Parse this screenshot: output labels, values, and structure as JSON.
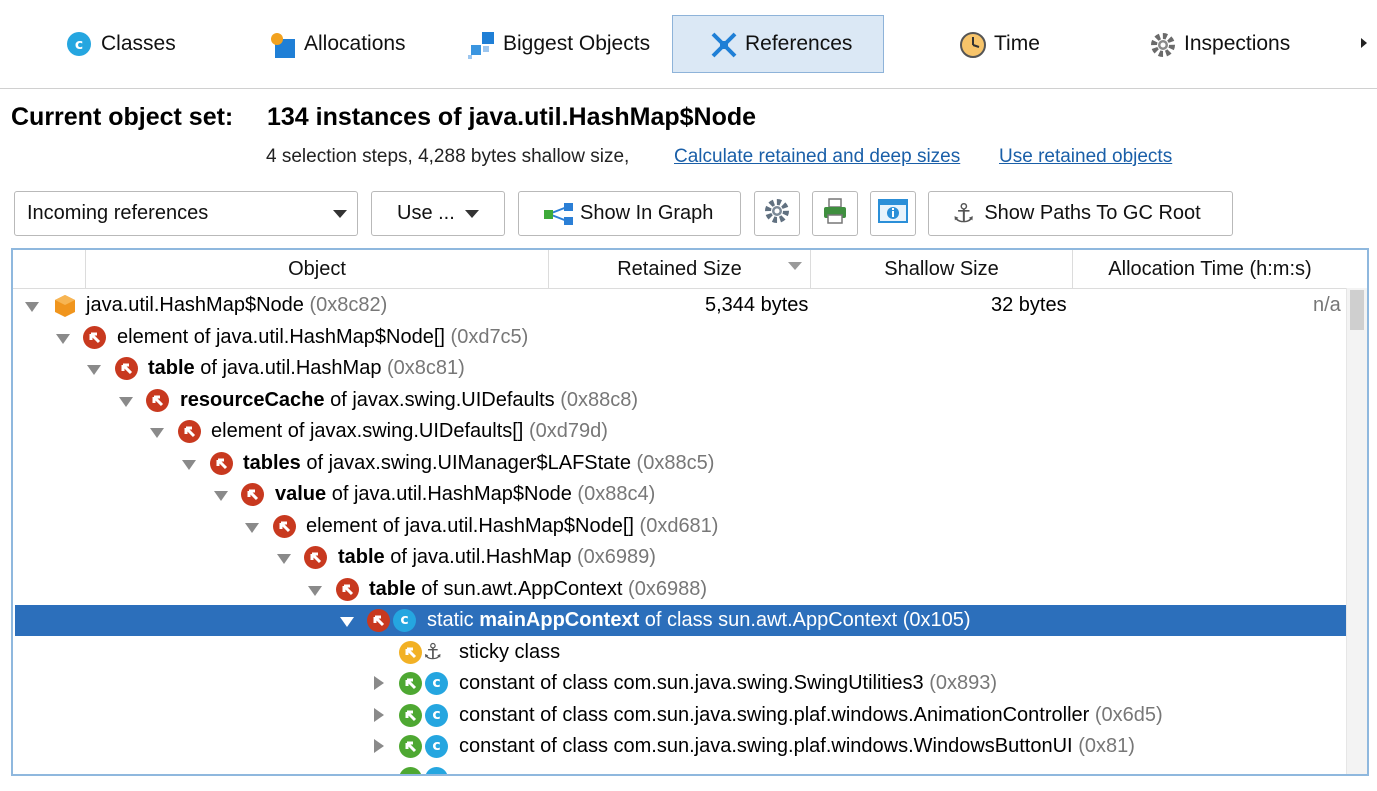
{
  "tabs": [
    {
      "label": "Classes",
      "icon": "classes-icon"
    },
    {
      "label": "Allocations",
      "icon": "allocations-icon"
    },
    {
      "label": "Biggest Objects",
      "icon": "biggest-objects-icon"
    },
    {
      "label": "References",
      "icon": "references-icon",
      "active": true
    },
    {
      "label": "Time",
      "icon": "time-icon"
    },
    {
      "label": "Inspections",
      "icon": "inspections-icon"
    }
  ],
  "header": {
    "label": "Current object set:",
    "value": "134 instances of java.util.HashMap$Node",
    "steps": "4 selection steps, 4,288 bytes shallow size,",
    "link_calc": "Calculate retained and deep sizes",
    "link_use": "Use retained objects"
  },
  "toolbar": {
    "mode_select": "Incoming references",
    "use_button": "Use ...",
    "graph_button": "Show In Graph",
    "gc_button": "Show Paths To GC Root"
  },
  "table": {
    "columns": [
      "Object",
      "Retained Size",
      "Shallow Size",
      "Allocation Time (h:m:s)"
    ],
    "rows": [
      {
        "bold": "",
        "pre": "",
        "text": "java.util.HashMap$Node",
        "addr": "(0x8c82)",
        "retained": "5,344 bytes",
        "shallow": "32 bytes",
        "time": "n/a"
      },
      {
        "bold": "",
        "pre": "",
        "text": "element of java.util.HashMap$Node[]",
        "addr": "(0xd7c5)"
      },
      {
        "bold": "table",
        "pre": "",
        "text": " of java.util.HashMap",
        "addr": "(0x8c81)"
      },
      {
        "bold": "resourceCache",
        "pre": "",
        "text": " of javax.swing.UIDefaults",
        "addr": "(0x88c8)"
      },
      {
        "bold": "",
        "pre": "",
        "text": "element of javax.swing.UIDefaults[]",
        "addr": "(0xd79d)"
      },
      {
        "bold": "tables",
        "pre": "",
        "text": " of javax.swing.UIManager$LAFState",
        "addr": "(0x88c5)"
      },
      {
        "bold": "value",
        "pre": "",
        "text": " of java.util.HashMap$Node",
        "addr": "(0x88c4)"
      },
      {
        "bold": "",
        "pre": "",
        "text": "element of java.util.HashMap$Node[]",
        "addr": "(0xd681)"
      },
      {
        "bold": "table",
        "pre": "",
        "text": " of java.util.HashMap",
        "addr": "(0x6989)"
      },
      {
        "bold": "table",
        "pre": "",
        "text": " of sun.awt.AppContext",
        "addr": "(0x6988)"
      },
      {
        "bold": "mainAppContext",
        "pre": "static ",
        "text": " of class sun.awt.AppContext",
        "addr": "(0x105)"
      },
      {
        "bold": "",
        "pre": "",
        "text": "sticky class",
        "addr": ""
      },
      {
        "bold": "",
        "pre": "",
        "text": "constant of class com.sun.java.swing.SwingUtilities3",
        "addr": "(0x893)"
      },
      {
        "bold": "",
        "pre": "",
        "text": "constant of class com.sun.java.swing.plaf.windows.AnimationController",
        "addr": "(0x6d5)"
      },
      {
        "bold": "",
        "pre": "",
        "text": "constant of class com.sun.java.swing.plaf.windows.WindowsButtonUI",
        "addr": "(0x81)"
      }
    ]
  }
}
